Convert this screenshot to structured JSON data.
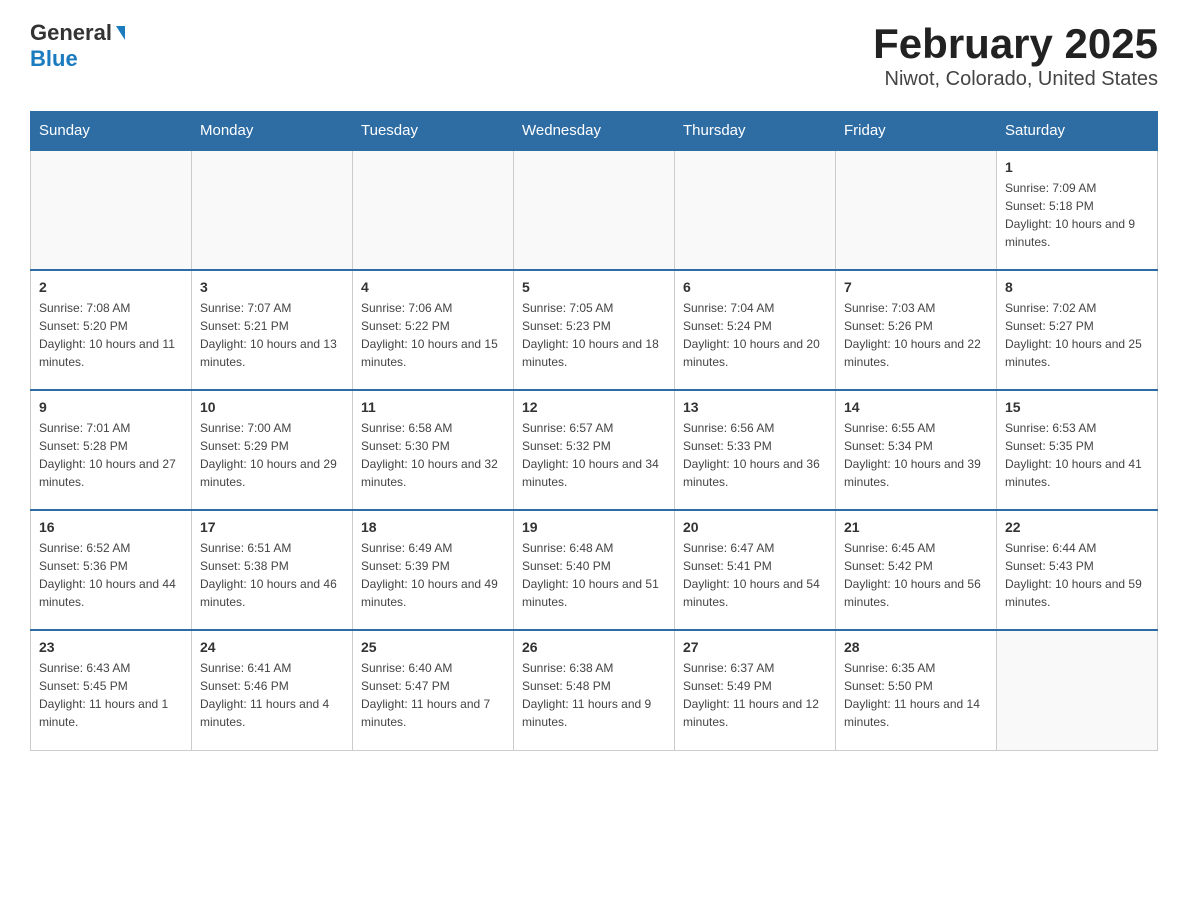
{
  "header": {
    "logo_general": "General",
    "logo_blue": "Blue",
    "title": "February 2025",
    "subtitle": "Niwot, Colorado, United States"
  },
  "days_of_week": [
    "Sunday",
    "Monday",
    "Tuesday",
    "Wednesday",
    "Thursday",
    "Friday",
    "Saturday"
  ],
  "weeks": [
    [
      {
        "day": "",
        "info": ""
      },
      {
        "day": "",
        "info": ""
      },
      {
        "day": "",
        "info": ""
      },
      {
        "day": "",
        "info": ""
      },
      {
        "day": "",
        "info": ""
      },
      {
        "day": "",
        "info": ""
      },
      {
        "day": "1",
        "info": "Sunrise: 7:09 AM\nSunset: 5:18 PM\nDaylight: 10 hours and 9 minutes."
      }
    ],
    [
      {
        "day": "2",
        "info": "Sunrise: 7:08 AM\nSunset: 5:20 PM\nDaylight: 10 hours and 11 minutes."
      },
      {
        "day": "3",
        "info": "Sunrise: 7:07 AM\nSunset: 5:21 PM\nDaylight: 10 hours and 13 minutes."
      },
      {
        "day": "4",
        "info": "Sunrise: 7:06 AM\nSunset: 5:22 PM\nDaylight: 10 hours and 15 minutes."
      },
      {
        "day": "5",
        "info": "Sunrise: 7:05 AM\nSunset: 5:23 PM\nDaylight: 10 hours and 18 minutes."
      },
      {
        "day": "6",
        "info": "Sunrise: 7:04 AM\nSunset: 5:24 PM\nDaylight: 10 hours and 20 minutes."
      },
      {
        "day": "7",
        "info": "Sunrise: 7:03 AM\nSunset: 5:26 PM\nDaylight: 10 hours and 22 minutes."
      },
      {
        "day": "8",
        "info": "Sunrise: 7:02 AM\nSunset: 5:27 PM\nDaylight: 10 hours and 25 minutes."
      }
    ],
    [
      {
        "day": "9",
        "info": "Sunrise: 7:01 AM\nSunset: 5:28 PM\nDaylight: 10 hours and 27 minutes."
      },
      {
        "day": "10",
        "info": "Sunrise: 7:00 AM\nSunset: 5:29 PM\nDaylight: 10 hours and 29 minutes."
      },
      {
        "day": "11",
        "info": "Sunrise: 6:58 AM\nSunset: 5:30 PM\nDaylight: 10 hours and 32 minutes."
      },
      {
        "day": "12",
        "info": "Sunrise: 6:57 AM\nSunset: 5:32 PM\nDaylight: 10 hours and 34 minutes."
      },
      {
        "day": "13",
        "info": "Sunrise: 6:56 AM\nSunset: 5:33 PM\nDaylight: 10 hours and 36 minutes."
      },
      {
        "day": "14",
        "info": "Sunrise: 6:55 AM\nSunset: 5:34 PM\nDaylight: 10 hours and 39 minutes."
      },
      {
        "day": "15",
        "info": "Sunrise: 6:53 AM\nSunset: 5:35 PM\nDaylight: 10 hours and 41 minutes."
      }
    ],
    [
      {
        "day": "16",
        "info": "Sunrise: 6:52 AM\nSunset: 5:36 PM\nDaylight: 10 hours and 44 minutes."
      },
      {
        "day": "17",
        "info": "Sunrise: 6:51 AM\nSunset: 5:38 PM\nDaylight: 10 hours and 46 minutes."
      },
      {
        "day": "18",
        "info": "Sunrise: 6:49 AM\nSunset: 5:39 PM\nDaylight: 10 hours and 49 minutes."
      },
      {
        "day": "19",
        "info": "Sunrise: 6:48 AM\nSunset: 5:40 PM\nDaylight: 10 hours and 51 minutes."
      },
      {
        "day": "20",
        "info": "Sunrise: 6:47 AM\nSunset: 5:41 PM\nDaylight: 10 hours and 54 minutes."
      },
      {
        "day": "21",
        "info": "Sunrise: 6:45 AM\nSunset: 5:42 PM\nDaylight: 10 hours and 56 minutes."
      },
      {
        "day": "22",
        "info": "Sunrise: 6:44 AM\nSunset: 5:43 PM\nDaylight: 10 hours and 59 minutes."
      }
    ],
    [
      {
        "day": "23",
        "info": "Sunrise: 6:43 AM\nSunset: 5:45 PM\nDaylight: 11 hours and 1 minute."
      },
      {
        "day": "24",
        "info": "Sunrise: 6:41 AM\nSunset: 5:46 PM\nDaylight: 11 hours and 4 minutes."
      },
      {
        "day": "25",
        "info": "Sunrise: 6:40 AM\nSunset: 5:47 PM\nDaylight: 11 hours and 7 minutes."
      },
      {
        "day": "26",
        "info": "Sunrise: 6:38 AM\nSunset: 5:48 PM\nDaylight: 11 hours and 9 minutes."
      },
      {
        "day": "27",
        "info": "Sunrise: 6:37 AM\nSunset: 5:49 PM\nDaylight: 11 hours and 12 minutes."
      },
      {
        "day": "28",
        "info": "Sunrise: 6:35 AM\nSunset: 5:50 PM\nDaylight: 11 hours and 14 minutes."
      },
      {
        "day": "",
        "info": ""
      }
    ]
  ]
}
